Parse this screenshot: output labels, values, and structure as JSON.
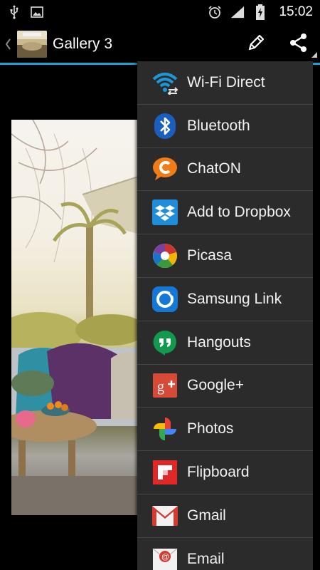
{
  "status_bar": {
    "time": "15:02",
    "icons_left": [
      "usb-icon",
      "image-notification-icon"
    ],
    "icons_right": [
      "alarm-icon",
      "signal-icon",
      "battery-charging-icon"
    ]
  },
  "action_bar": {
    "title": "Gallery 3",
    "actions": [
      "edit-pencil-icon",
      "share-icon"
    ],
    "accent_color": "#1da1d4"
  },
  "share_menu": {
    "items": [
      {
        "label": "Wi-Fi Direct",
        "icon": "wifi-direct-icon"
      },
      {
        "label": "Bluetooth",
        "icon": "bluetooth-icon"
      },
      {
        "label": "ChatON",
        "icon": "chaton-icon"
      },
      {
        "label": "Add to Dropbox",
        "icon": "dropbox-icon"
      },
      {
        "label": "Picasa",
        "icon": "picasa-icon"
      },
      {
        "label": "Samsung Link",
        "icon": "samsung-link-icon"
      },
      {
        "label": "Hangouts",
        "icon": "hangouts-icon"
      },
      {
        "label": "Google+",
        "icon": "google-plus-icon"
      },
      {
        "label": "Photos",
        "icon": "photos-icon"
      },
      {
        "label": "Flipboard",
        "icon": "flipboard-icon"
      },
      {
        "label": "Gmail",
        "icon": "gmail-icon"
      },
      {
        "label": "Email",
        "icon": "email-icon"
      }
    ]
  }
}
